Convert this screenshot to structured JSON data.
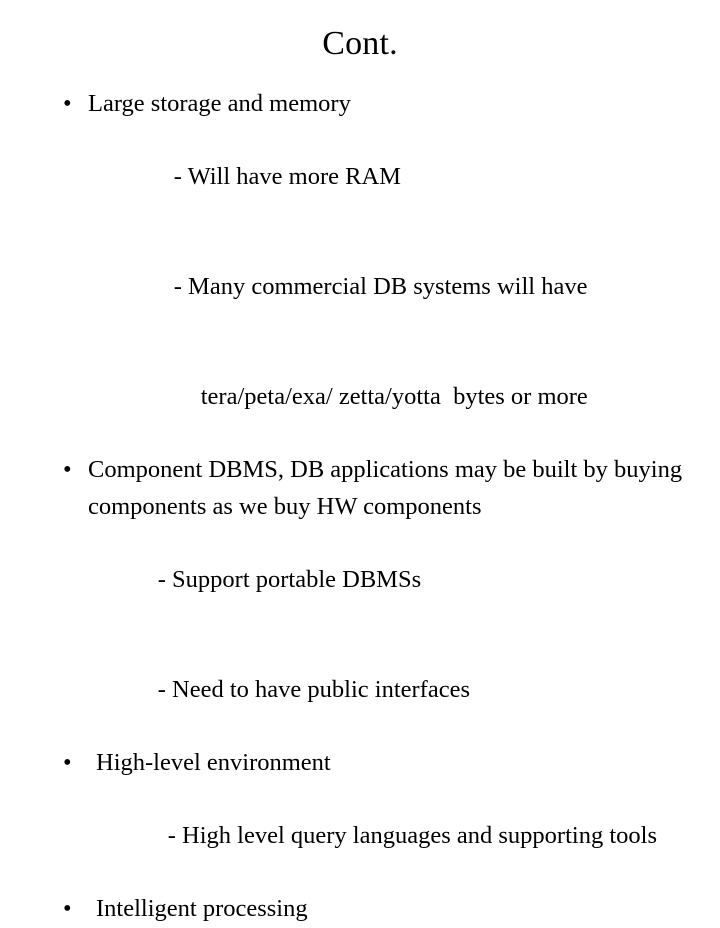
{
  "slide": {
    "title": "Cont.",
    "bullet_glyph": "•",
    "dash_glyph": "-",
    "content": [
      {
        "kind": "bullet",
        "level": 1,
        "text": "Large storage and memory"
      },
      {
        "kind": "dash",
        "level": 2,
        "text": "- Will have more RAM"
      },
      {
        "kind": "dash",
        "level": 2,
        "text": "- Many commercial DB systems will have"
      },
      {
        "kind": "plain",
        "level": 3,
        "text": "tera/peta/exa/ zetta/yotta  bytes or more"
      },
      {
        "kind": "bullet",
        "level": 1,
        "text": "Component DBMS, DB applications may be built by buying components as we buy HW components"
      },
      {
        "kind": "dash",
        "level": 2,
        "text": "- Support portable DBMSs"
      },
      {
        "kind": "dash",
        "level": 2,
        "text": "- Need to have public interfaces"
      },
      {
        "kind": "bullet",
        "level": 1,
        "text": "High-level environment"
      },
      {
        "kind": "dash",
        "level": 2,
        "text": "- High level query languages and supporting tools"
      },
      {
        "kind": "bullet",
        "level": 1,
        "text": "Intelligent processing"
      }
    ]
  },
  "colors": {
    "background": "#ffffff",
    "text": "#000000"
  }
}
